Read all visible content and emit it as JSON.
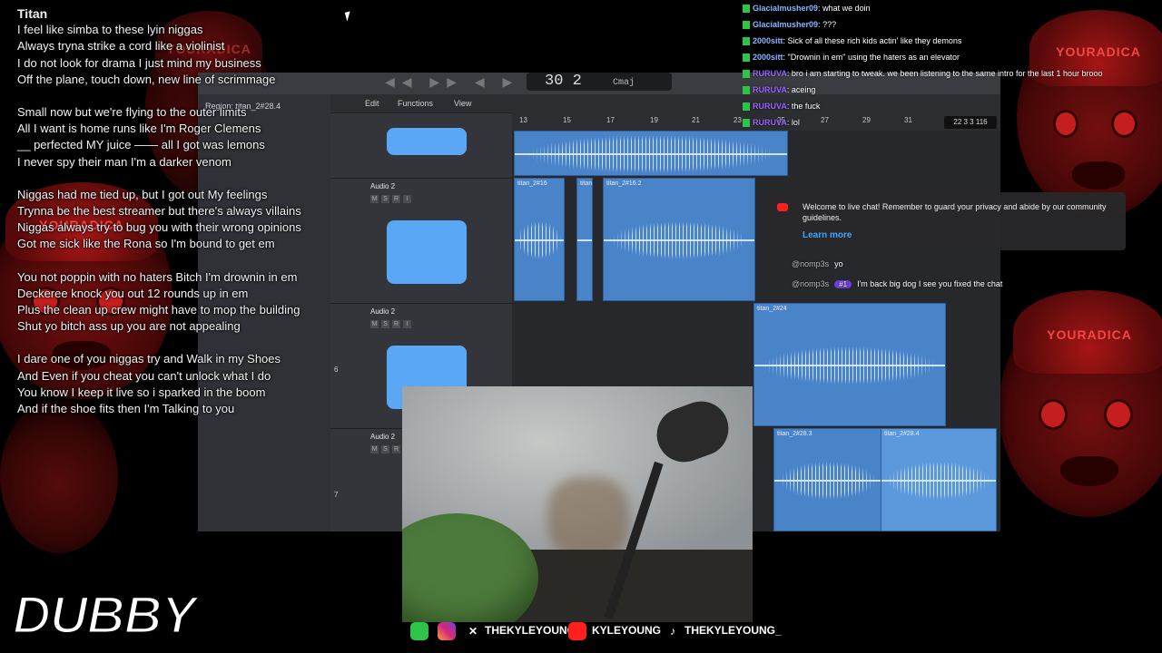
{
  "overlay": {
    "logo_text": "DUBBY",
    "cap_text": "YOURADICA"
  },
  "lyrics": {
    "title": "Titan",
    "stanzas": [
      [
        "I feel like simba to these lyin niggas",
        "Always tryna strike a cord like a violinist",
        "I do not look for drama I just mind my business",
        "Off the plane, touch down, new line of scrimmage"
      ],
      [
        "Small now but we're flying to the outer limits",
        "All I want is home runs like I'm Roger Clemens",
        "__ perfected MY juice —— all I got was lemons",
        "I never spy  their man I'm a darker venom"
      ],
      [
        "Niggas had me tied up, but I got out My feelings",
        "Trynna be the best streamer  but there's always villains",
        "Niggas always try to bug you with their wrong opinions",
        "Got me sick like the Rona so I'm bound to get em"
      ],
      [
        "You not poppin with no haters Bitch I'm drownin in em",
        "Deckeree knock you out 12 rounds up in em",
        "Plus the clean up crew might have to mop the building",
        "Shut yo bitch ass up you are not appealing"
      ],
      [
        "I dare one of you niggas try and Walk in my Shoes",
        "And Even if you cheat you can't unlock what I do",
        "You know I keep it live so i sparked in the boom",
        "And if the shoe fits  then I'm Talking to you"
      ]
    ]
  },
  "daw": {
    "region_label": "Region: titan_2#28.4",
    "lcd_main": "30  2",
    "lcd_key": "Cmaj",
    "menu": [
      "Edit",
      "Functions",
      "View"
    ],
    "ruler_ticks": [
      "13",
      "15",
      "17",
      "19",
      "21",
      "23",
      "25",
      "27",
      "29",
      "31"
    ],
    "tracks": [
      {
        "name": "Audio 2",
        "num": "",
        "mute": "M",
        "solo": "S",
        "rec": "R",
        "input": "I"
      },
      {
        "name": "Audio 2",
        "num": "6",
        "mute": "M",
        "solo": "S",
        "rec": "R",
        "input": "I"
      },
      {
        "name": "Audio 2",
        "num": "7",
        "mute": "M",
        "solo": "S",
        "rec": "R",
        "input": "I"
      }
    ],
    "regions": [
      "titan_2#16",
      "titan",
      "titan_2#16.2",
      "titan_2#24",
      "titan_2#28.3",
      "titan_2#28.4"
    ],
    "position_readout": "22 3 3 116"
  },
  "chat": {
    "messages": [
      {
        "user": "Glacialmusher09",
        "text": "what we doin"
      },
      {
        "user": "Glacialmusher09",
        "text": "???"
      },
      {
        "user": "2000sitt",
        "text": "Sick of all these rich kids actin' like they demons"
      },
      {
        "user": "2000sitt",
        "text": "\"Drownin in em\" using the haters as an elevator"
      },
      {
        "user": "RURUVA",
        "text": "bro i am starting to tweak. we been listening to the same intro for the last 1 hour brooo"
      },
      {
        "user": "RURUVA",
        "text": "aceing"
      },
      {
        "user": "RURUVA",
        "text": "the fuck"
      },
      {
        "user": "RURUVA",
        "text": "lol"
      }
    ],
    "welcome_text": "Welcome to live chat! Remember to guard your privacy and abide by our community guidelines.",
    "learn_more": "Learn more",
    "yt_messages": [
      {
        "user": "@nomp3s",
        "badge": "",
        "text": "yo"
      },
      {
        "user": "@nomp3s",
        "badge": "#1",
        "text": "I'm back big dog I see you fixed the chat"
      }
    ]
  },
  "social": [
    {
      "platform": "x",
      "handle": "THEKYLEYOUNG"
    },
    {
      "platform": "youtube",
      "handle": "KYLEYOUNG"
    },
    {
      "platform": "tiktok",
      "handle": "THEKYLEYOUNG_"
    }
  ],
  "colors": {
    "accent_blue": "#4a84c8",
    "kick_green": "#2ec44a",
    "youtube_red": "#ff1f1f",
    "background_red": "#7a1010"
  }
}
